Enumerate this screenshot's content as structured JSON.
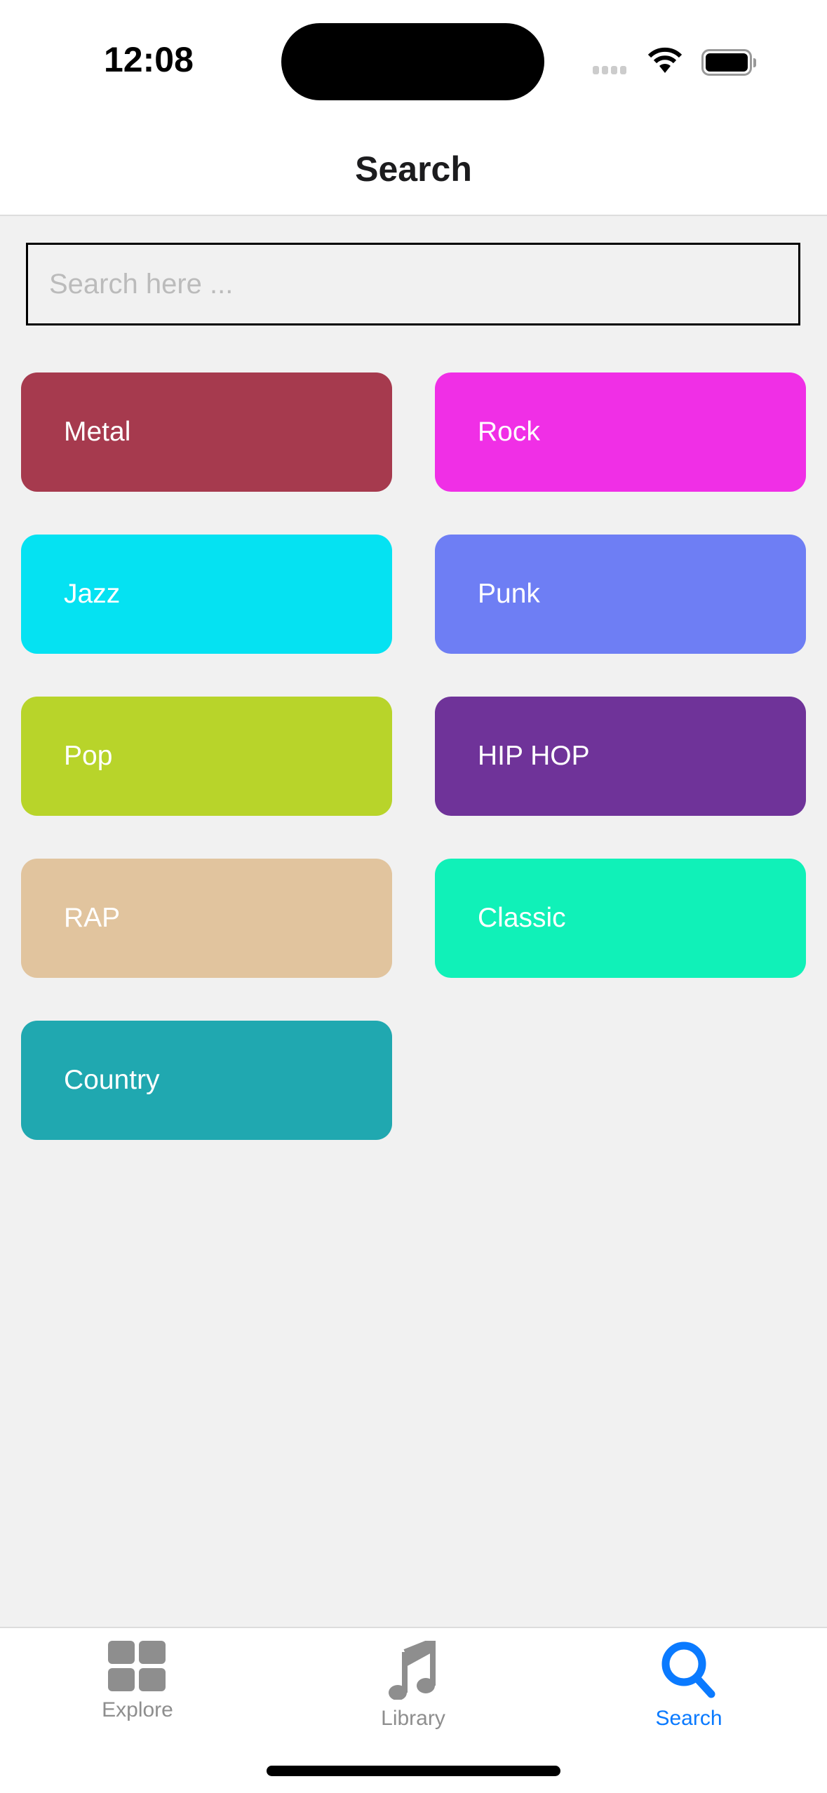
{
  "status_bar": {
    "time": "12:08"
  },
  "header": {
    "title": "Search"
  },
  "search": {
    "placeholder": "Search here ...",
    "value": ""
  },
  "genres": [
    {
      "label": "Metal",
      "color": "#A63A4E"
    },
    {
      "label": "Rock",
      "color": "#F02FE6"
    },
    {
      "label": "Jazz",
      "color": "#05E2F2"
    },
    {
      "label": "Punk",
      "color": "#6E7EF4"
    },
    {
      "label": "Pop",
      "color": "#B8D42A"
    },
    {
      "label": "HIP HOP",
      "color": "#6F3399"
    },
    {
      "label": "RAP",
      "color": "#E1C49E"
    },
    {
      "label": "Classic",
      "color": "#10F1B8"
    },
    {
      "label": "Country",
      "color": "#20A8B0"
    }
  ],
  "tabs": [
    {
      "label": "Explore",
      "icon": "grid-icon",
      "active": false
    },
    {
      "label": "Library",
      "icon": "music-note-icon",
      "active": false
    },
    {
      "label": "Search",
      "icon": "search-icon",
      "active": true
    }
  ],
  "colors": {
    "accent": "#0A7AFF",
    "inactive": "#8E8E8E"
  }
}
